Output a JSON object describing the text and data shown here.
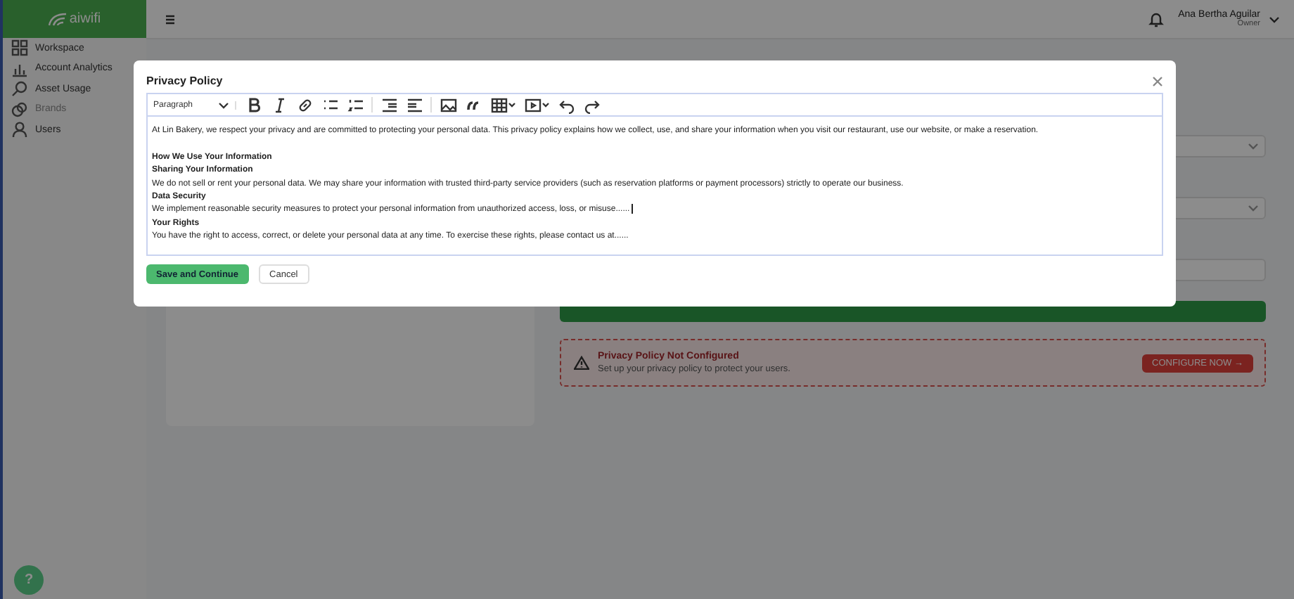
{
  "sidebar": {
    "logo": "aiwifi",
    "items": [
      {
        "label": "Workspace",
        "selected": false
      },
      {
        "label": "Account Analytics",
        "selected": false
      },
      {
        "label": "Asset Usage",
        "selected": false
      },
      {
        "label": "Brands",
        "selected": true
      },
      {
        "label": "Users",
        "selected": false
      }
    ]
  },
  "topbar": {
    "user_name": "Ana Bertha Aguilar",
    "user_role": "Owner"
  },
  "alert": {
    "title": "Privacy Policy Not Configured",
    "message": "Set up your privacy policy to protect your users.",
    "button": "CONFIGURE NOW →"
  },
  "help_button": "?",
  "modal": {
    "title": "Privacy Policy",
    "toolbar": {
      "block_style": "Paragraph"
    },
    "content": [
      {
        "kind": "text",
        "text": "At Lin Bakery, we respect your privacy and are committed to protecting your personal data. This privacy policy explains how we collect, use, and share your information when you visit our restaurant, use our website, or make a reservation.",
        "cursor": false
      },
      {
        "kind": "blank"
      },
      {
        "kind": "heading",
        "text": "How We Use Your Information",
        "cursor": false
      },
      {
        "kind": "heading",
        "text": "Sharing Your Information",
        "cursor": false
      },
      {
        "kind": "text",
        "text": "We do not sell or rent your personal data. We may share your information with trusted third-party service providers (such as reservation platforms or payment processors) strictly to operate our business.",
        "cursor": false
      },
      {
        "kind": "heading",
        "text": "Data Security",
        "cursor": false
      },
      {
        "kind": "text",
        "text": "We implement reasonable security measures to protect your personal information from unauthorized access, loss, or misuse......",
        "cursor": true
      },
      {
        "kind": "heading",
        "text": "Your Rights",
        "cursor": false
      },
      {
        "kind": "text",
        "text": "You have the right to access, correct, or delete your personal data at any time. To exercise these rights, please contact us at......",
        "cursor": false
      }
    ],
    "buttons": [
      {
        "kind": "primary",
        "label": "Save and Continue"
      },
      {
        "kind": "secondary",
        "label": "Cancel"
      }
    ]
  }
}
